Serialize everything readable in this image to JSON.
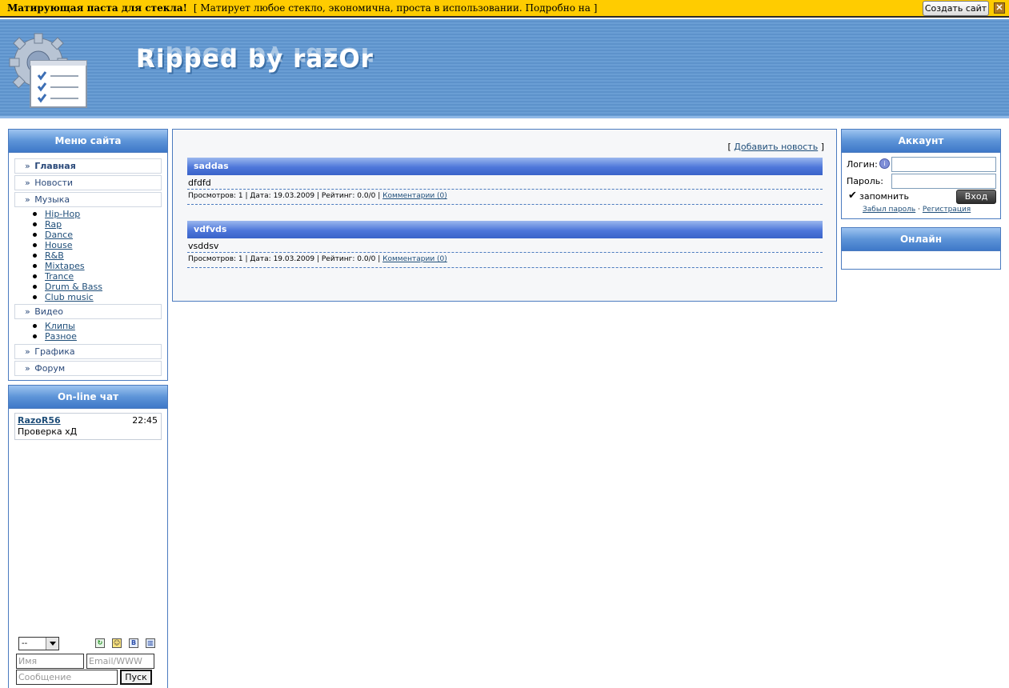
{
  "adbar": {
    "title": "Матирующая паста для стекла!",
    "text": "[ Матирует любое стекло, экономична, проста в использовании. Подробно на ]",
    "create_label": "Создать сайт",
    "close_label": "✕"
  },
  "header": {
    "site_title": "Ripped by razOr"
  },
  "menu": {
    "title": "Меню сайта",
    "items": [
      {
        "label": "Главная"
      },
      {
        "label": "Новости"
      },
      {
        "label": "Музыка",
        "sub": [
          "Hip-Hop",
          "Rap",
          "Dance",
          "House",
          "R&B",
          "Mixtapes",
          "Trance",
          "Drum & Bass",
          "Club music"
        ]
      },
      {
        "label": "Видео",
        "sub": [
          "Клипы",
          "Разное"
        ]
      },
      {
        "label": "Графика"
      },
      {
        "label": "Форум"
      }
    ],
    "arrow": "»"
  },
  "chat": {
    "title": "On-line чат",
    "messages": [
      {
        "user": "RazoR56",
        "time": "22:45",
        "text": "Проверка хД"
      }
    ],
    "select_value": "--",
    "icons": [
      "refresh-icon",
      "smiley-icon",
      "bbcode-icon",
      "settings-icon"
    ],
    "name_placeholder": "Имя",
    "email_placeholder": "Email/WWW",
    "message_placeholder": "Сообщение",
    "send_label": "Пуск"
  },
  "news": {
    "add_link": "Добавить новость",
    "bracket_open": "[",
    "bracket_close": "]",
    "items": [
      {
        "title": "saddas",
        "body": "dfdfd",
        "meta": "Просмотров: 1 | Дата: 19.03.2009 | Рейтинг: 0.0/0 |",
        "comments": "Комментарии (0)"
      },
      {
        "title": "vdfvds",
        "body": "vsddsv",
        "meta": "Просмотров: 1 | Дата: 19.03.2009 | Рейтинг: 0.0/0 |",
        "comments": "Комментарии (0)"
      }
    ]
  },
  "account": {
    "title": "Аккаунт",
    "login_label": "Логин:",
    "password_label": "Пароль:",
    "remember_label": "запомнить",
    "login_button": "Вход",
    "forgot_link": "Забыл пароль",
    "separator": "·",
    "register_link": "Регистрация"
  },
  "online": {
    "title": "Онлайн"
  },
  "colors": {
    "adbar": "#ffcc00",
    "header": "#6a9ed4",
    "block_border": "#4b7bbf",
    "news_title": "#4e77da"
  }
}
